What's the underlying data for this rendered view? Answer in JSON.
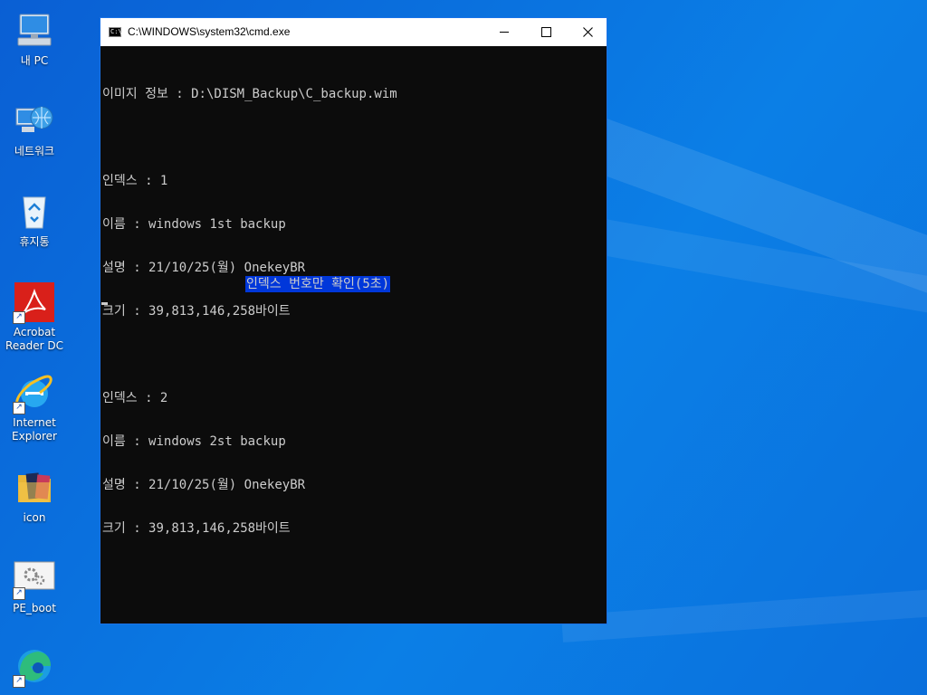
{
  "desktop": {
    "icons": [
      {
        "label": "내 PC",
        "icon": "computer-icon",
        "shortcut": false
      },
      {
        "label": "네트워크",
        "icon": "network-globe-icon",
        "shortcut": false
      },
      {
        "label": "휴지통",
        "icon": "recycle-bin-icon",
        "shortcut": false
      },
      {
        "label": "Acrobat Reader DC",
        "icon": "acrobat-icon",
        "shortcut": true
      },
      {
        "label": "Internet Explorer",
        "icon": "internet-explorer-icon",
        "shortcut": true
      },
      {
        "label": "icon",
        "icon": "folder-icon",
        "shortcut": false
      },
      {
        "label": "PE_boot",
        "icon": "settings-gears-icon",
        "shortcut": true
      },
      {
        "label": "",
        "icon": "edge-icon",
        "shortcut": true
      }
    ]
  },
  "window": {
    "title": "C:\\WINDOWS\\system32\\cmd.exe",
    "icon_glyph": "C:\\",
    "colors": {
      "titlebar": "#ffffff",
      "console_bg": "#0c0c0c",
      "console_text": "#cccccc",
      "highlight": "#0037da"
    }
  },
  "console": {
    "image_info": "이미지 정보 : D:\\DISM_Backup\\C_backup.wim",
    "entries": [
      {
        "index": "인덱스 : 1",
        "name": "이름 : windows 1st backup",
        "desc": "설명 : 21/10/25(월) OnekeyBR",
        "size": "크기 : 39,813,146,258바이트"
      },
      {
        "index": "인덱스 : 2",
        "name": "이름 : windows 2st backup",
        "desc": "설명 : 21/10/25(월) OnekeyBR",
        "size": "크기 : 39,813,146,258바이트"
      }
    ],
    "prompt_highlight": "인덱스 번호만 확인(5초)"
  }
}
